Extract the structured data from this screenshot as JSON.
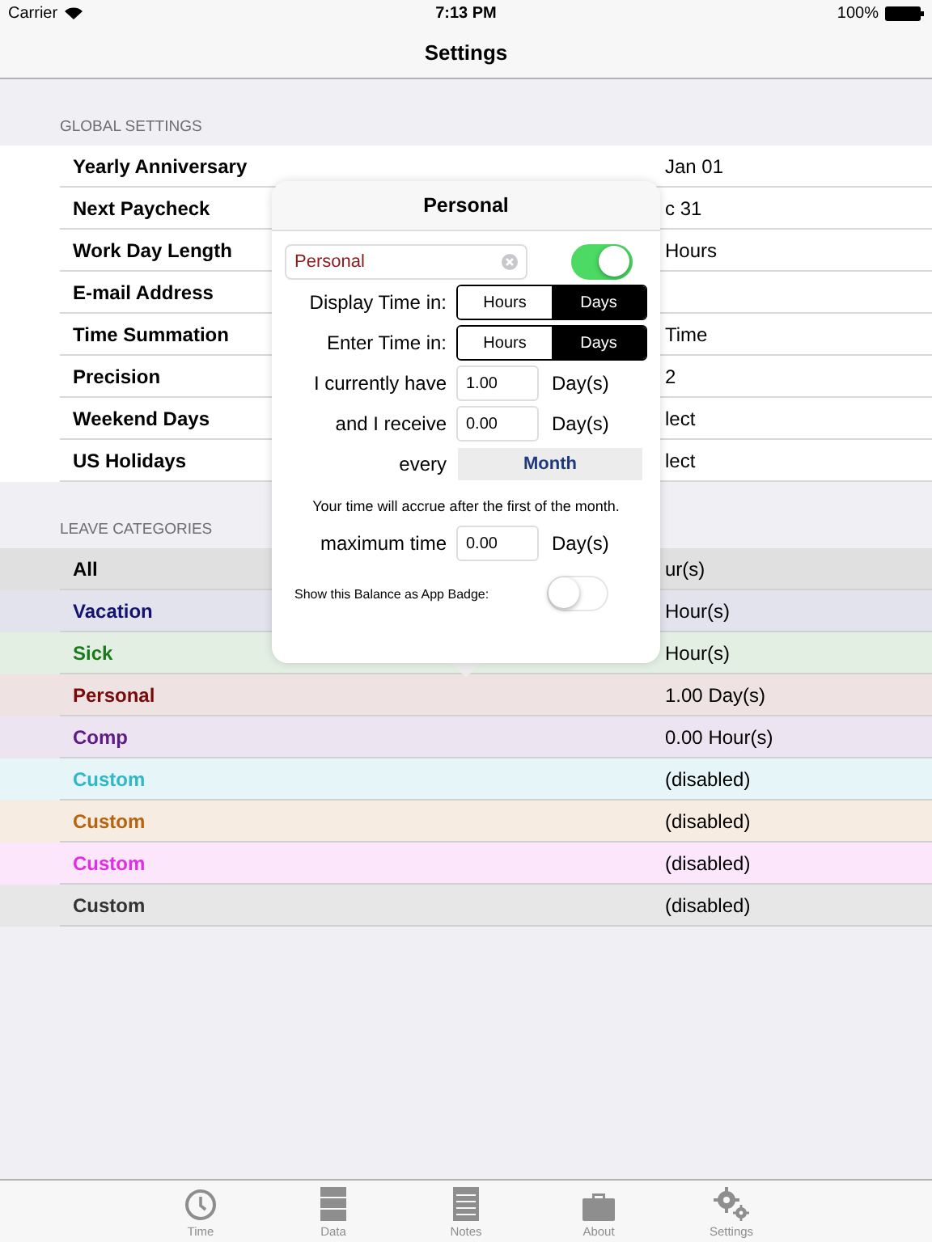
{
  "status_bar": {
    "carrier": "Carrier",
    "time": "7:13 PM",
    "battery": "100%"
  },
  "nav": {
    "title": "Settings"
  },
  "global_settings": {
    "header": "GLOBAL SETTINGS",
    "rows": [
      {
        "label": "Yearly Anniversary",
        "value": "Jan 01"
      },
      {
        "label": "Next Paycheck",
        "value": "c 31"
      },
      {
        "label": "Work Day Length",
        "value": "Hours"
      },
      {
        "label": "E-mail Address"
      },
      {
        "label": "Time Summation",
        "value": "Time"
      },
      {
        "label": "Precision",
        "value": "2"
      },
      {
        "label": "Weekend Days",
        "value": "lect"
      },
      {
        "label": "US Holidays",
        "value": "lect"
      }
    ]
  },
  "leave_categories": {
    "header": "LEAVE CATEGORIES",
    "rows": [
      {
        "label": "All",
        "value": "ur(s)",
        "color": "#000000"
      },
      {
        "label": "Vacation",
        "value": "Hour(s)",
        "color": "#14146e"
      },
      {
        "label": "Sick",
        "value": "Hour(s)",
        "color": "#1a7a1a"
      },
      {
        "label": "Personal",
        "value": "1.00 Day(s)",
        "color": "#7a0a0a"
      },
      {
        "label": "Comp",
        "value": "0.00 Hour(s)",
        "color": "#5e1a86"
      },
      {
        "label": "Custom",
        "value": "(disabled)",
        "color": "#2fb8c6"
      },
      {
        "label": "Custom",
        "value": "(disabled)",
        "color": "#b8640e"
      },
      {
        "label": "Custom",
        "value": "(disabled)",
        "color": "#e02ee6"
      },
      {
        "label": "Custom",
        "value": "(disabled)",
        "color": "#333333"
      }
    ]
  },
  "popover": {
    "title": "Personal",
    "name_value": "Personal",
    "enabled_on": true,
    "display_label": "Display Time in:",
    "display_segments": [
      {
        "label": "Hours",
        "selected": false
      },
      {
        "label": "Days",
        "selected": true
      }
    ],
    "enter_label": "Enter Time in:",
    "enter_segments": [
      {
        "label": "Hours",
        "selected": false
      },
      {
        "label": "Days",
        "selected": true
      }
    ],
    "have_label": "I currently have",
    "have_value": "1.00",
    "have_unit": "Day(s)",
    "receive_label": "and I receive",
    "receive_value": "0.00",
    "receive_unit": "Day(s)",
    "every_label": "every",
    "every_button": "Month",
    "note": "Your time will accrue after the first of the month.",
    "max_label": "maximum time",
    "max_value": "0.00",
    "max_unit": "Day(s)",
    "badge_label": "Show this Balance as App Badge:",
    "badge_on": false
  },
  "tab_bar": [
    {
      "label": "Time",
      "kind": "clock"
    },
    {
      "label": "Data",
      "kind": "drawers"
    },
    {
      "label": "Notes",
      "kind": "notepad"
    },
    {
      "label": "About",
      "kind": "briefcase"
    },
    {
      "label": "Settings",
      "kind": "gears"
    }
  ]
}
